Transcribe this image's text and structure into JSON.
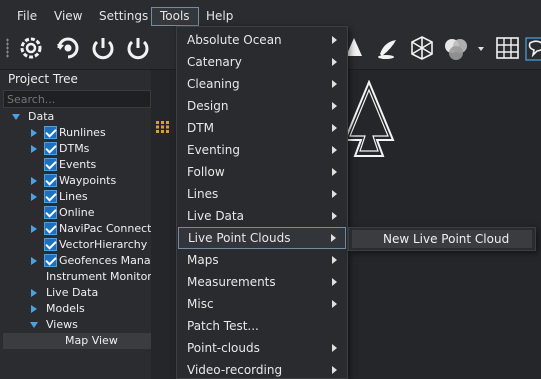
{
  "menubar": {
    "items": [
      "File",
      "View",
      "Settings",
      "Tools",
      "Help"
    ]
  },
  "project_tree": {
    "title": "Project Tree",
    "search_placeholder": "Search...",
    "items": [
      {
        "label": "Data",
        "expanded": true
      },
      {
        "label": "Runlines",
        "checked": true
      },
      {
        "label": "DTMs",
        "checked": true
      },
      {
        "label": "Events",
        "checked": true
      },
      {
        "label": "Waypoints",
        "checked": true
      },
      {
        "label": "Lines",
        "checked": true
      },
      {
        "label": "Online",
        "checked": true
      },
      {
        "label": "NaviPac Connectio",
        "checked": true
      },
      {
        "label": "VectorHierarchy",
        "checked": true
      },
      {
        "label": "Geofences Manage",
        "checked": true
      },
      {
        "label": "Instrument Monitor"
      },
      {
        "label": "Live Data"
      },
      {
        "label": "Models"
      },
      {
        "label": "Views",
        "expanded": true
      },
      {
        "label": "Map View",
        "selected": true
      }
    ]
  },
  "tools_menu": {
    "items": [
      {
        "label": "Absolute Ocean",
        "submenu": true
      },
      {
        "label": "Catenary",
        "submenu": true
      },
      {
        "label": "Cleaning",
        "submenu": true
      },
      {
        "label": "Design",
        "submenu": true
      },
      {
        "label": "DTM",
        "submenu": true
      },
      {
        "label": "Eventing",
        "submenu": true
      },
      {
        "label": "Follow",
        "submenu": true
      },
      {
        "label": "Lines",
        "submenu": true
      },
      {
        "label": "Live Data",
        "submenu": true
      },
      {
        "label": "Live Point Clouds",
        "submenu": true,
        "highlighted": true
      },
      {
        "label": "Maps",
        "submenu": true
      },
      {
        "label": "Measurements",
        "submenu": true
      },
      {
        "label": "Misc",
        "submenu": true
      },
      {
        "label": "Patch Test...",
        "submenu": false
      },
      {
        "label": "Point-clouds",
        "submenu": true
      },
      {
        "label": "Video-recording",
        "submenu": true
      }
    ]
  },
  "submenu": {
    "items": [
      "New Live Point Cloud"
    ]
  },
  "toolbar": {
    "icons": [
      "gear-cycle-icon",
      "gear-refresh-icon",
      "power-refresh-icon",
      "power-signal-icon",
      "arrow-up-icon",
      "pen-icon",
      "cube-icon",
      "spheres-icon",
      "grid-icon",
      "speech-bubble-icon"
    ]
  },
  "colors": {
    "accent": "#4aa3e0",
    "highlight_border": "#6f8ea6",
    "background": "#252629",
    "panel": "#2b2c2f"
  }
}
